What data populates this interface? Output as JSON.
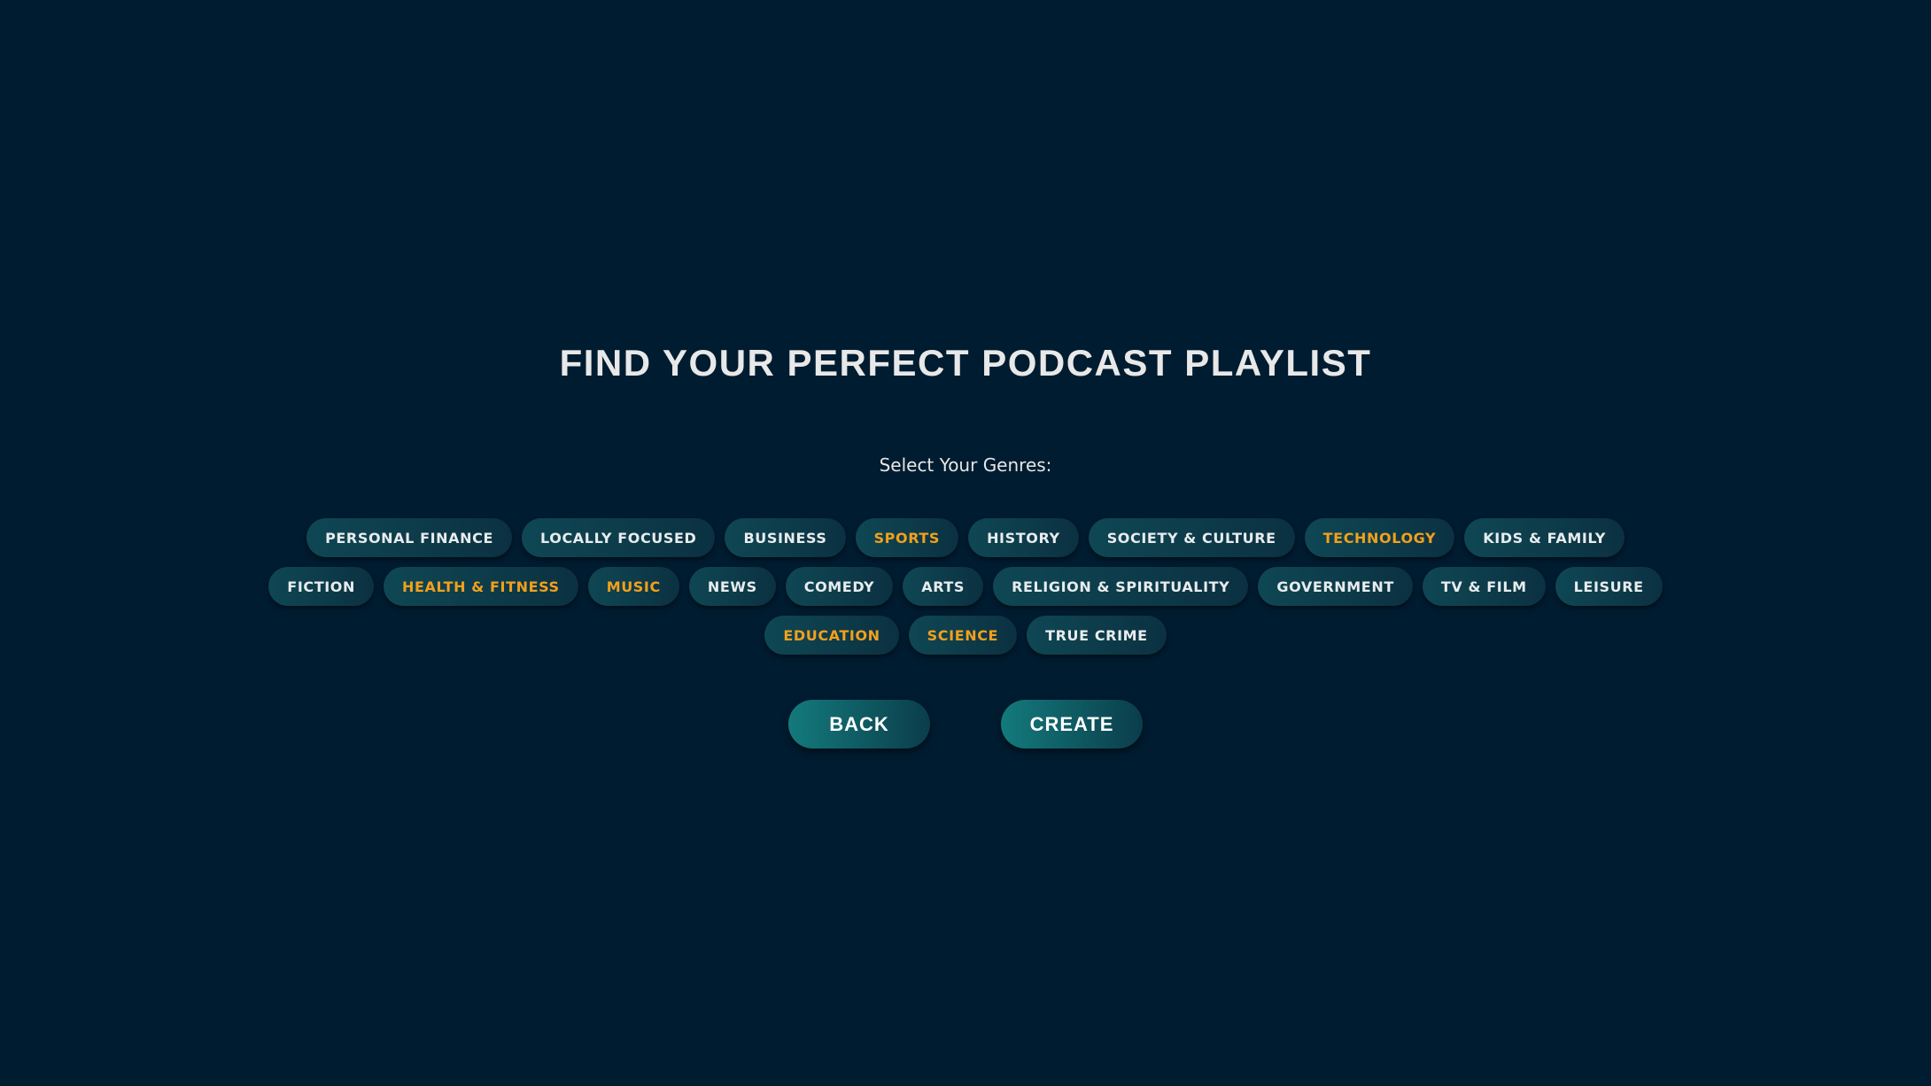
{
  "title": "FIND YOUR PERFECT PODCAST PLAYLIST",
  "genres_label": "Select Your Genres:",
  "genre_rows": [
    [
      {
        "label": "PERSONAL FINANCE",
        "selected": false
      },
      {
        "label": "LOCALLY FOCUSED",
        "selected": false
      },
      {
        "label": "BUSINESS",
        "selected": false
      },
      {
        "label": "SPORTS",
        "selected": true
      },
      {
        "label": "HISTORY",
        "selected": false
      },
      {
        "label": "SOCIETY & CULTURE",
        "selected": false
      },
      {
        "label": "TECHNOLOGY",
        "selected": true
      },
      {
        "label": "KIDS & FAMILY",
        "selected": false
      }
    ],
    [
      {
        "label": "FICTION",
        "selected": false
      },
      {
        "label": "HEALTH & FITNESS",
        "selected": true
      },
      {
        "label": "MUSIC",
        "selected": true
      },
      {
        "label": "NEWS",
        "selected": false
      },
      {
        "label": "COMEDY",
        "selected": false
      },
      {
        "label": "ARTS",
        "selected": false
      },
      {
        "label": "RELIGION & SPIRITUALITY",
        "selected": false
      },
      {
        "label": "GOVERNMENT",
        "selected": false
      },
      {
        "label": "TV & FILM",
        "selected": false
      },
      {
        "label": "LEISURE",
        "selected": false
      }
    ],
    [
      {
        "label": "EDUCATION",
        "selected": true
      },
      {
        "label": "SCIENCE",
        "selected": true
      },
      {
        "label": "TRUE CRIME",
        "selected": false
      }
    ]
  ],
  "actions": {
    "back_label": "BACK",
    "create_label": "CREATE"
  },
  "colors": {
    "background": "#001c30",
    "selected_text": "#f2a01c",
    "chip_text": "#e8ecee",
    "button_accent": "#137a7c"
  }
}
